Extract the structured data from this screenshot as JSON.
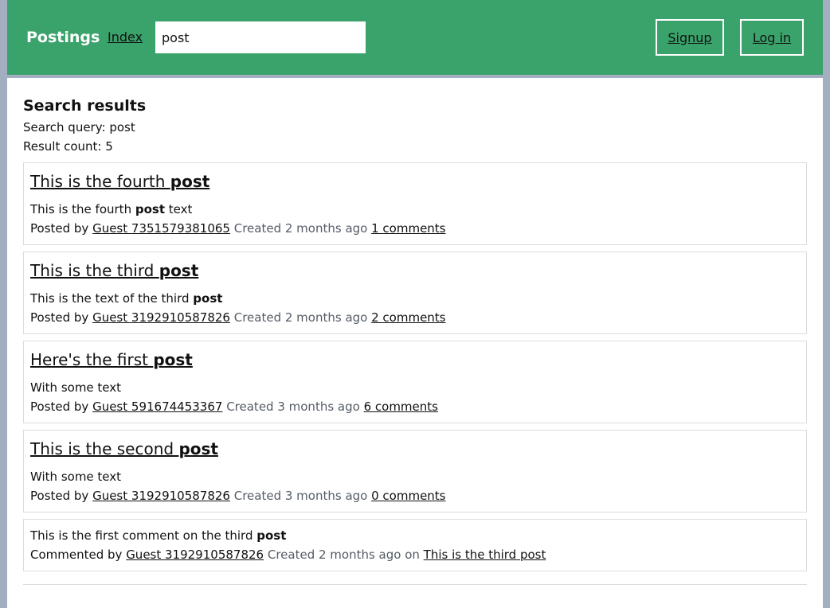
{
  "header": {
    "brand": "Postings",
    "index_link": "Index",
    "search_value": "post",
    "signup": "Signup",
    "login": "Log in"
  },
  "results": {
    "title": "Search results",
    "query_label": "Search query: ",
    "query": "post",
    "count_label": "Result count: ",
    "count": "5"
  },
  "posts": [
    {
      "title_pre": "This is the fourth ",
      "title_hl": "post",
      "body_pre": "This is the fourth ",
      "body_hl": "post",
      "body_post": " text",
      "posted_by": "Posted by ",
      "author": "Guest 7351579381065",
      "created": " Created 2 months ago ",
      "comments": "1 comments"
    },
    {
      "title_pre": "This is the third ",
      "title_hl": "post",
      "body_pre": "This is the text of the third ",
      "body_hl": "post",
      "body_post": "",
      "posted_by": "Posted by ",
      "author": "Guest 3192910587826",
      "created": " Created 2 months ago ",
      "comments": "2 comments"
    },
    {
      "title_pre": "Here's the first ",
      "title_hl": "post",
      "body_pre": "With some text",
      "body_hl": "",
      "body_post": "",
      "posted_by": "Posted by ",
      "author": "Guest 591674453367",
      "created": " Created 3 months ago ",
      "comments": "6 comments"
    },
    {
      "title_pre": "This is the second ",
      "title_hl": "post",
      "body_pre": "With some text",
      "body_hl": "",
      "body_post": "",
      "posted_by": "Posted by ",
      "author": "Guest 3192910587826",
      "created": " Created 3 months ago ",
      "comments": "0 comments"
    }
  ],
  "comment": {
    "body_pre": "This is the first comment on the third ",
    "body_hl": "post",
    "commented_by": "Commented by ",
    "author": "Guest 3192910587826",
    "created": " Created 2 months ago on ",
    "post_link": "This is the third post"
  },
  "colors": {
    "header_bg": "#3aa36b",
    "page_bg": "#a3aec0",
    "muted_text": "#555c66"
  }
}
